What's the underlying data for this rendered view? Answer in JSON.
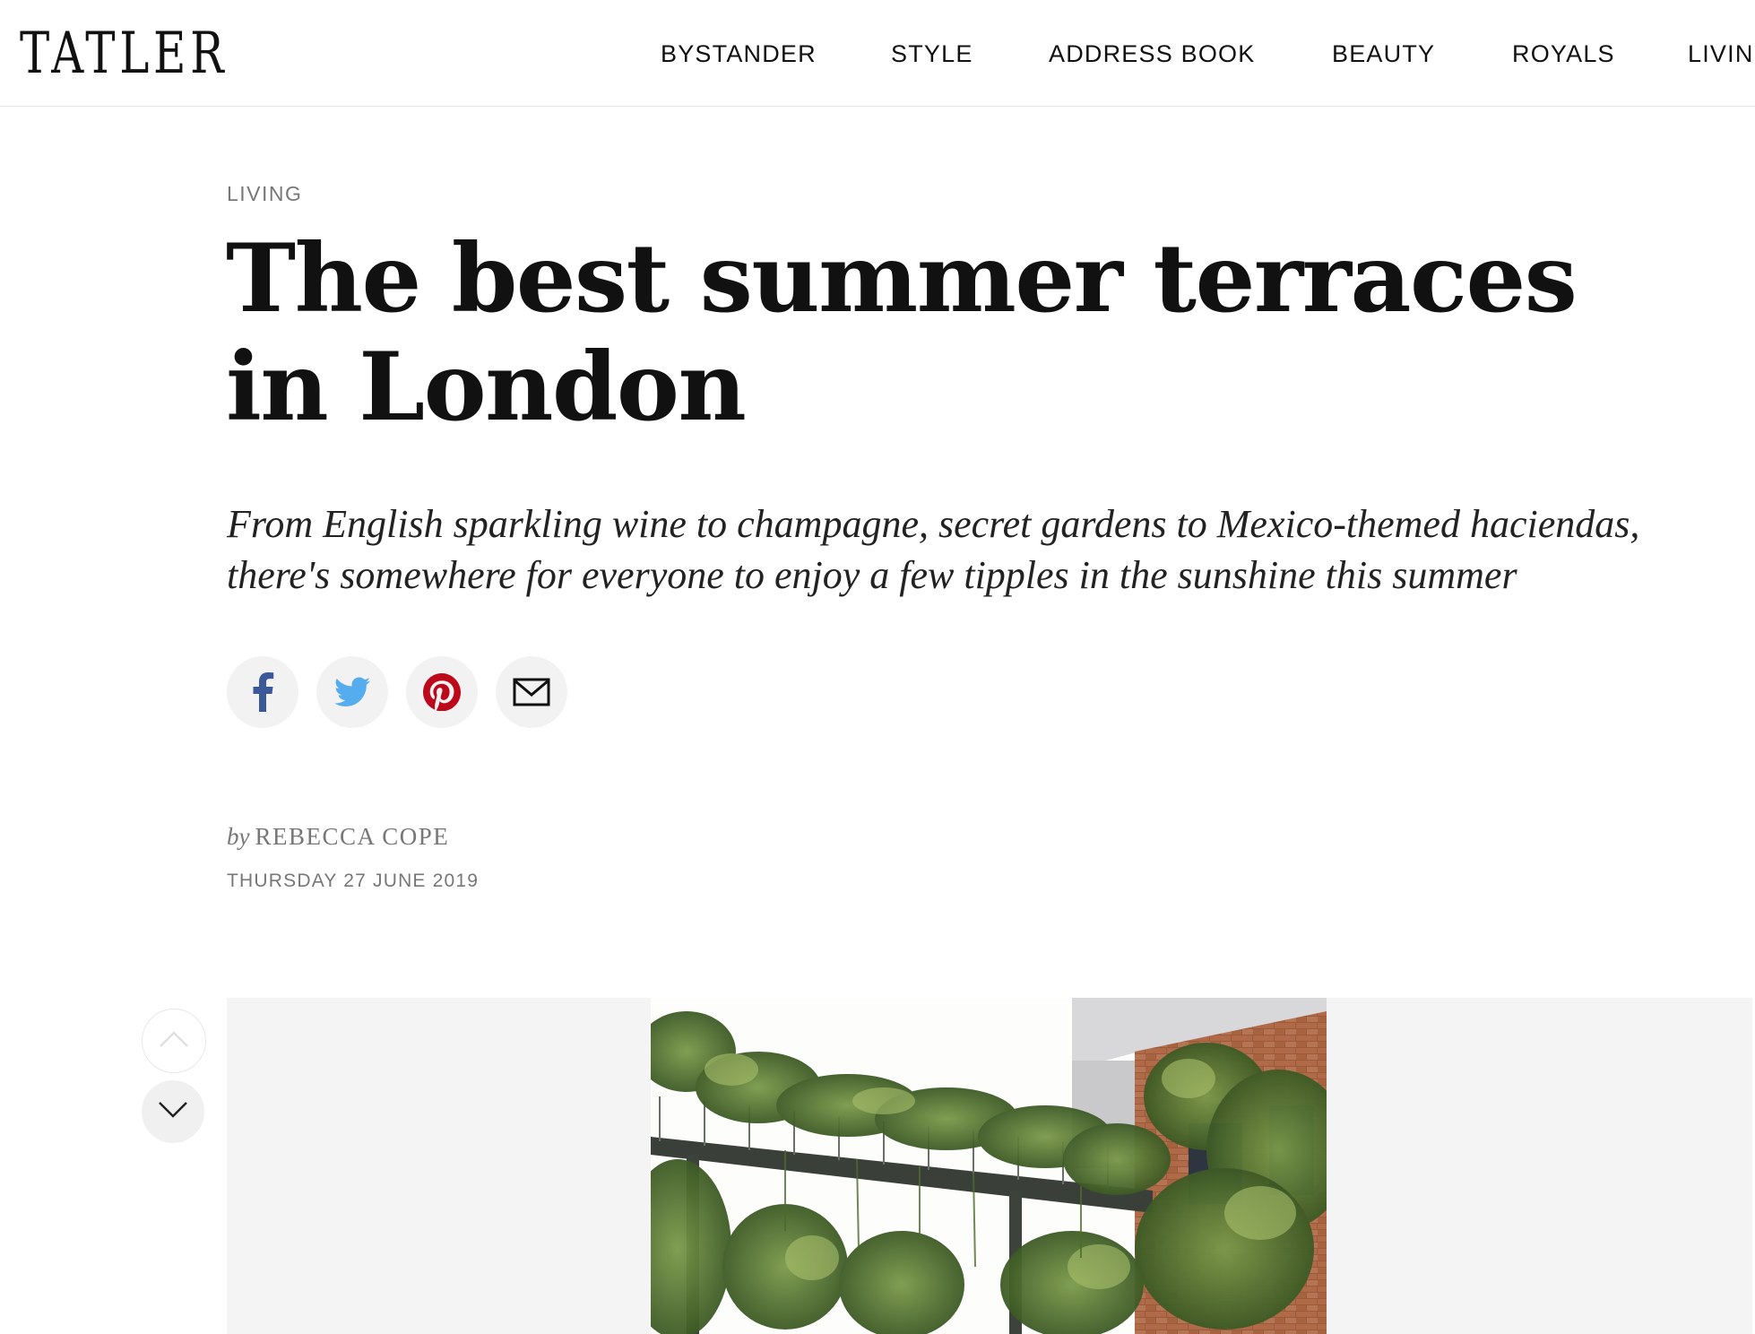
{
  "header": {
    "logo": "TATLER",
    "nav": [
      {
        "label": "BYSTANDER"
      },
      {
        "label": "STYLE"
      },
      {
        "label": "ADDRESS BOOK"
      },
      {
        "label": "BEAUTY"
      },
      {
        "label": "ROYALS"
      },
      {
        "label": "LIVIN"
      }
    ]
  },
  "article": {
    "category": "LIVING",
    "headline": "The best summer terraces in London",
    "dek": "From English sparkling wine to champagne, secret gardens to Mexico-themed haciendas, there's somewhere for everyone to enjoy a few tipples in the sunshine this summer",
    "byline_prefix": "by",
    "author": "REBECCA COPE",
    "date": "THURSDAY 27 JUNE 2019"
  },
  "share": [
    {
      "icon": "facebook-icon",
      "color": "#3b5998"
    },
    {
      "icon": "twitter-icon",
      "color": "#55acee"
    },
    {
      "icon": "pinterest-icon",
      "color": "#bd081c"
    },
    {
      "icon": "mail-icon",
      "color": "#111111"
    }
  ],
  "gallery": {
    "prev_icon": "chevron-up-icon",
    "next_icon": "chevron-down-icon",
    "image_subject": "ivy-covered brick building with walkway terrace"
  }
}
